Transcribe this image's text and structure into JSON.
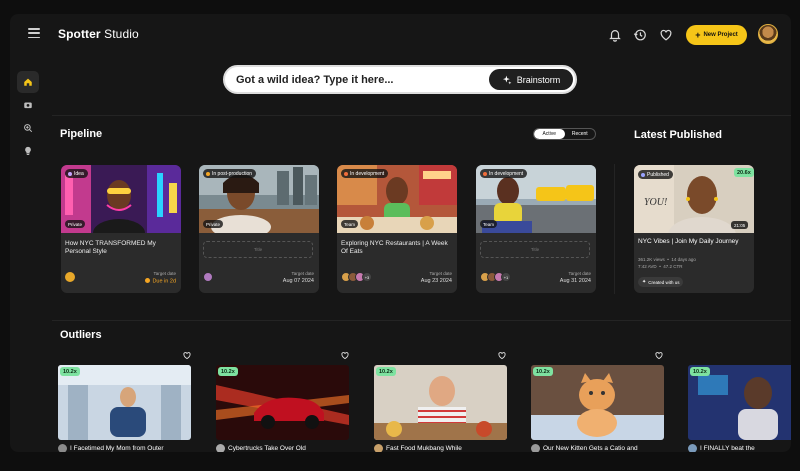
{
  "app": {
    "brand_bold": "Spotter",
    "brand_light": " Studio"
  },
  "header": {
    "new_project_label": "New Project",
    "icons": [
      "bell-icon",
      "history-icon",
      "heart-icon"
    ]
  },
  "sidebar": {
    "items": [
      {
        "icon": "home-icon",
        "active": true
      },
      {
        "icon": "camera-icon"
      },
      {
        "icon": "search-zoom-icon"
      },
      {
        "icon": "lightbulb-icon"
      }
    ]
  },
  "search": {
    "prompt": "Got a wild idea? Type it here...",
    "button": "Brainstorm"
  },
  "pipeline": {
    "title": "Pipeline",
    "toggle": {
      "active": "Active",
      "recent": "Recent"
    },
    "cards": [
      {
        "status": "Idea",
        "status_color": "#c7a4ff",
        "visibility": "Private",
        "title": "How NYC TRANSFORMED My Personal Style",
        "input": "",
        "target_label": "Target date",
        "target": "Due in 2d",
        "more": ""
      },
      {
        "status": "In post-production",
        "status_color": "#f5a623",
        "visibility": "Private",
        "title": "",
        "input": "Title",
        "target_label": "Target date",
        "target": "Aug 07 2024",
        "more": ""
      },
      {
        "status": "In development",
        "status_color": "#f06d3b",
        "visibility": "Team",
        "title": "Exploring NYC Restaurants | A Week Of Eats",
        "input": "",
        "target_label": "Target date",
        "target": "Aug 23 2024",
        "more": "+3"
      },
      {
        "status": "In development",
        "status_color": "#f06d3b",
        "visibility": "Team",
        "title": "",
        "input": "Title",
        "target_label": "Target date",
        "target": "Aug 31 2024",
        "more": "+1"
      }
    ]
  },
  "latest": {
    "title": "Latest Published",
    "status": "Published",
    "multiplier": "20.6x",
    "duration": "21:05",
    "video_title": "NYC Vibes | Join My Daily Journey",
    "views": "361.2K views",
    "age": "14 days ago",
    "avd": "7:42 AVD",
    "ctr": "47.2 CTR",
    "created_with": "Created with us"
  },
  "outliers": {
    "title": "Outliers",
    "items": [
      {
        "multiplier": "10.2x",
        "title": "I Facetimed My Mom from Outer"
      },
      {
        "multiplier": "10.2x",
        "title": "Cybertrucks Take Over Old"
      },
      {
        "multiplier": "10.2x",
        "title": "Fast Food Mukbang While"
      },
      {
        "multiplier": "10.2x",
        "title": "Our New Kitten Gets a Catio and"
      },
      {
        "multiplier": "10.2x",
        "title": "I FINALLY beat the"
      }
    ]
  },
  "colors": {
    "accent": "#f5c518",
    "badge_green": "#7ee2a0",
    "card_bg": "#2b2b2b",
    "app_bg": "#161616"
  }
}
